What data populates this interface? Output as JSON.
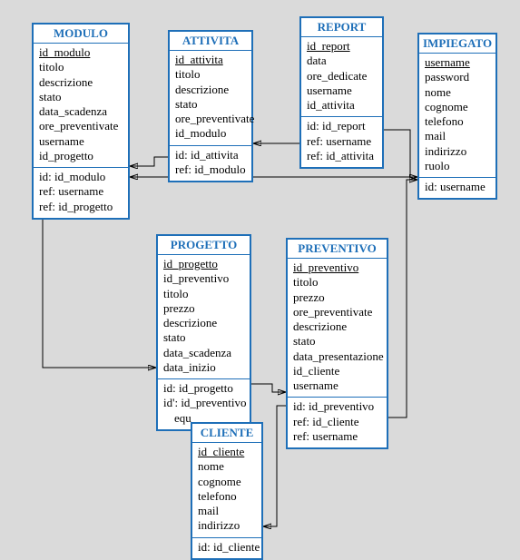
{
  "entities": {
    "modulo": {
      "title": "MODULO",
      "fields": [
        "id_modulo",
        "titolo",
        "descrizione",
        "stato",
        "data_scadenza",
        "ore_preventivate",
        "username",
        "id_progetto"
      ],
      "keys": [
        "id: id_modulo",
        "ref: username",
        "ref: id_progetto"
      ]
    },
    "attivita": {
      "title": "ATTIVITA",
      "fields": [
        "id_attivita",
        "titolo",
        "descrizione",
        "stato",
        "ore_preventivate",
        "id_modulo"
      ],
      "keys": [
        "id: id_attivita",
        "ref: id_modulo"
      ]
    },
    "report": {
      "title": "REPORT",
      "fields": [
        "id_report",
        "data",
        "ore_dedicate",
        "username",
        "id_attivita"
      ],
      "keys": [
        "id: id_report",
        "ref: username",
        "ref: id_attivita"
      ]
    },
    "impiegato": {
      "title": "IMPIEGATO",
      "fields": [
        "username",
        "password",
        "nome",
        "cognome",
        "telefono",
        "mail",
        "indirizzo",
        "ruolo"
      ],
      "keys": [
        "id: username"
      ]
    },
    "progetto": {
      "title": "PROGETTO",
      "fields": [
        "id_progetto",
        "id_preventivo",
        "titolo",
        "prezzo",
        "descrizione",
        "stato",
        "data_scadenza",
        "data_inizio"
      ],
      "keys": [
        "id: id_progetto",
        "id': id_preventivo",
        "equ"
      ]
    },
    "preventivo": {
      "title": "PREVENTIVO",
      "fields": [
        "id_preventivo",
        "titolo",
        "prezzo",
        "ore_preventivate",
        "descrizione",
        "stato",
        "data_presentazione",
        "id_cliente",
        "username"
      ],
      "keys": [
        "id: id_preventivo",
        "ref: id_cliente",
        "ref: username"
      ]
    },
    "cliente": {
      "title": "CLIENTE",
      "fields": [
        "id_cliente",
        "nome",
        "cognome",
        "telefono",
        "mail",
        "indirizzo"
      ],
      "keys": [
        "id: id_cliente"
      ]
    }
  }
}
